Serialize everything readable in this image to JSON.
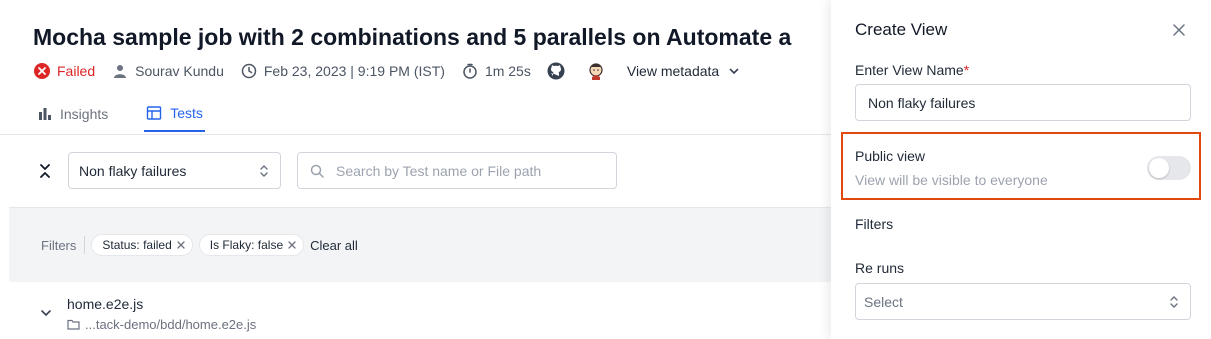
{
  "job": {
    "title": "Mocha sample job with 2 combinations and 5 parallels on Automate a",
    "status": "Failed",
    "user": "Sourav Kundu",
    "datetime": "Feb 23, 2023 | 9:19 PM (IST)",
    "duration": "1m 25s",
    "view_metadata": "View metadata"
  },
  "tabs": [
    {
      "label": "Insights",
      "icon": "bar-chart-icon"
    },
    {
      "label": "Tests",
      "icon": "table-icon",
      "active": true
    }
  ],
  "toolbar": {
    "view_select_value": "Non flaky failures",
    "search_placeholder": "Search by Test name or File path"
  },
  "filters": {
    "label": "Filters",
    "chips": [
      "Status: failed",
      "Is Flaky: false"
    ],
    "clear_all": "Clear all"
  },
  "file": {
    "name": "home.e2e.js",
    "path": "...tack-demo/bdd/home.e2e.js"
  },
  "drawer": {
    "title": "Create View",
    "name_label": "Enter View Name",
    "name_required_mark": "*",
    "name_value": "Non flaky failures",
    "public_title": "Public view",
    "public_subtitle": "View will be visible to everyone",
    "public_enabled": false,
    "filters_label": "Filters",
    "reruns_label": "Re runs",
    "reruns_placeholder": "Select"
  },
  "colors": {
    "accent": "#2563eb",
    "failed": "#dc2626",
    "highlight_border": "#e0480e"
  }
}
